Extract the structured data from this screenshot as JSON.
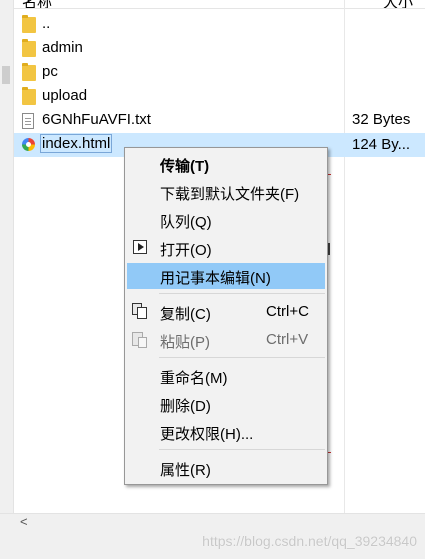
{
  "header": {
    "name_col": "名称",
    "size_col": "大小"
  },
  "files": [
    {
      "name": "..",
      "icon": "folder-icon",
      "size": ""
    },
    {
      "name": "admin",
      "icon": "folder-icon",
      "size": ""
    },
    {
      "name": "pc",
      "icon": "folder-icon",
      "size": ""
    },
    {
      "name": "upload",
      "icon": "folder-icon",
      "size": ""
    },
    {
      "name": "6GNhFuAVFI.txt",
      "icon": "text-file-icon",
      "size": "32 Bytes"
    },
    {
      "name": "index.html",
      "icon": "html-file-icon",
      "size": "124 By..."
    }
  ],
  "context_menu": {
    "items": [
      {
        "label": "传输(T)",
        "bold": true
      },
      {
        "label": "下载到默认文件夹(F)"
      },
      {
        "label": "队列(Q)"
      },
      {
        "label": "打开(O)",
        "icon": "open-icon"
      },
      {
        "label": "用记事本编辑(N)",
        "highlighted": true
      },
      {
        "label": "复制(C)",
        "shortcut": "Ctrl+C",
        "icon": "copy-icon"
      },
      {
        "label": "粘贴(P)",
        "shortcut": "Ctrl+V",
        "icon": "paste-icon",
        "disabled": true
      },
      {
        "label": "重命名(M)"
      },
      {
        "label": "删除(D)"
      },
      {
        "label": "更改权限(H)..."
      },
      {
        "label": "属性(R)"
      }
    ]
  },
  "scrollbar": {
    "left_arrow": "<"
  },
  "watermark": "https://blog.csdn.net/qq_39234840",
  "colors": {
    "selection": "#cce8ff",
    "menu_highlight": "#91c9f7",
    "menu_bg": "#f2f2f2"
  }
}
